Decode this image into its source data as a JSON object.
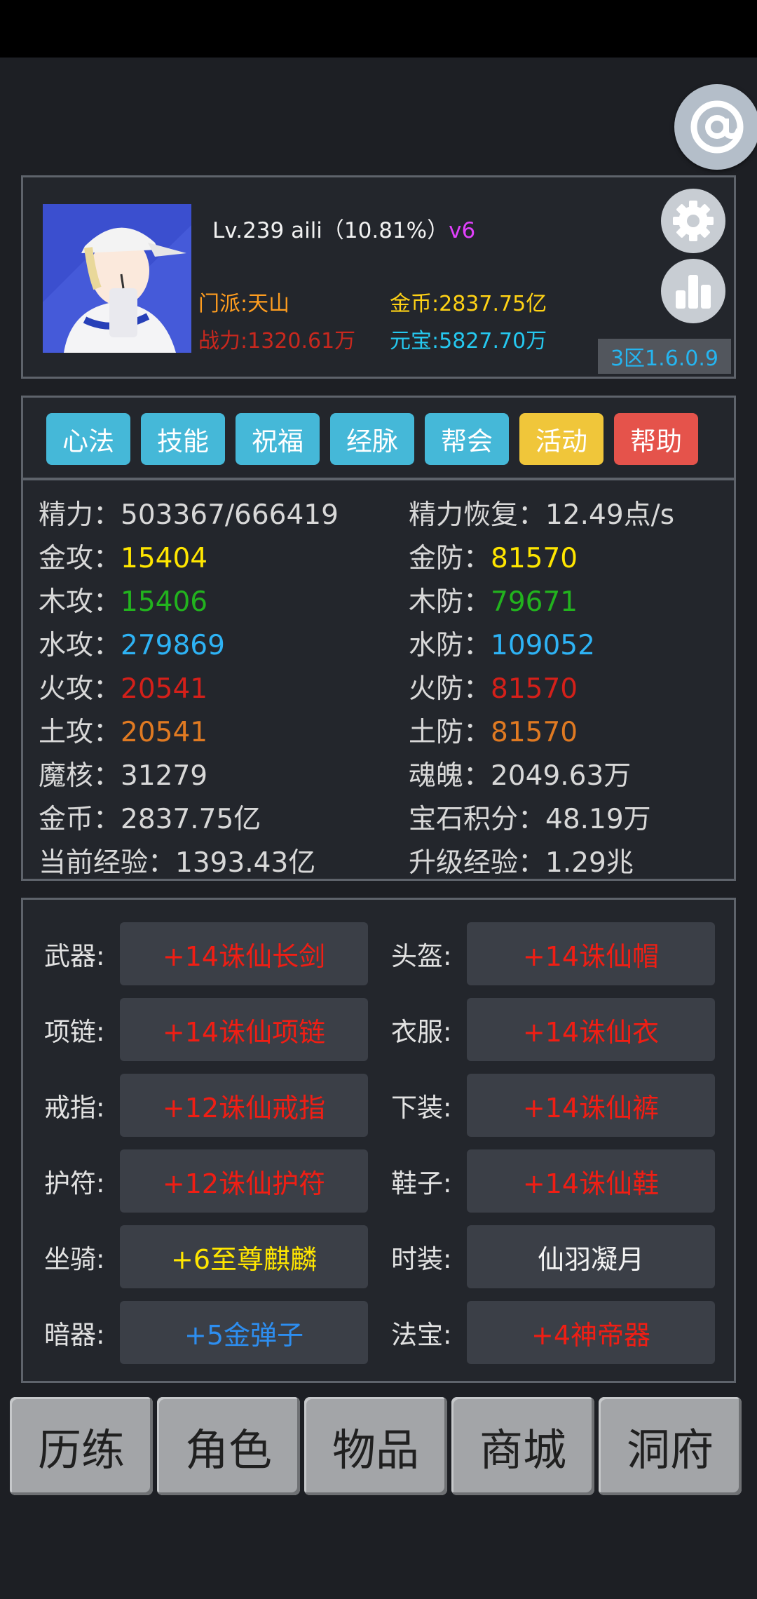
{
  "profile": {
    "level_line": "Lv.239 aili（10.81%）",
    "vip": "v6",
    "sect": "门派:天山",
    "gold": "金币:2837.75亿",
    "power": "战力:1320.61万",
    "yuanbao": "元宝:5827.70万",
    "version": "3区1.6.0.9"
  },
  "tabs": [
    {
      "label": "心法",
      "color": "#45b8d8"
    },
    {
      "label": "技能",
      "color": "#45b8d8"
    },
    {
      "label": "祝福",
      "color": "#45b8d8"
    },
    {
      "label": "经脉",
      "color": "#45b8d8"
    },
    {
      "label": "帮会",
      "color": "#45b8d8"
    },
    {
      "label": "活动",
      "color": "#f0c63a"
    },
    {
      "label": "帮助",
      "color": "#e5534b"
    }
  ],
  "stats": {
    "energy_label": "精力：",
    "energy": "503367/666419",
    "regen_label": "精力恢复：",
    "regen": "12.49点/s",
    "metal_atk_label": "金攻：",
    "metal_atk": "15404",
    "metal_def_label": "金防：",
    "metal_def": "81570",
    "wood_atk_label": "木攻：",
    "wood_atk": "15406",
    "wood_def_label": "木防：",
    "wood_def": "79671",
    "water_atk_label": "水攻：",
    "water_atk": "279869",
    "water_def_label": "水防：",
    "water_def": "109052",
    "fire_atk_label": "火攻：",
    "fire_atk": "20541",
    "fire_def_label": "火防：",
    "fire_def": "81570",
    "earth_atk_label": "土攻：",
    "earth_atk": "20541",
    "earth_def_label": "土防：",
    "earth_def": "81570",
    "core_label": "魔核：",
    "core": "31279",
    "soul_label": "魂魄：",
    "soul": "2049.63万",
    "coin_label": "金币：",
    "coin": "2837.75亿",
    "gem_label": "宝石积分：",
    "gem": "48.19万",
    "exp_label": "当前经验：",
    "exp": "1393.43亿",
    "next_label": "升级经验：",
    "next": "1.29兆"
  },
  "equip": {
    "weapon_label": "武器:",
    "weapon": "+14诛仙长剑",
    "helmet_label": "头盔:",
    "helmet": "+14诛仙帽",
    "necklace_label": "项链:",
    "necklace": "+14诛仙项链",
    "armor_label": "衣服:",
    "armor": "+14诛仙衣",
    "ring_label": "戒指:",
    "ring": "+12诛仙戒指",
    "pants_label": "下装:",
    "pants": "+14诛仙裤",
    "amulet_label": "护符:",
    "amulet": "+12诛仙护符",
    "shoes_label": "鞋子:",
    "shoes": "+14诛仙鞋",
    "mount_label": "坐骑:",
    "mount": "+6至尊麒麟",
    "fashion_label": "时装:",
    "fashion": "仙羽凝月",
    "hidden_label": "暗器:",
    "hidden": "+5金弹子",
    "treasure_label": "法宝:",
    "treasure": "+4神帝器"
  },
  "nav": [
    "历练",
    "角色",
    "物品",
    "商城",
    "洞府"
  ]
}
